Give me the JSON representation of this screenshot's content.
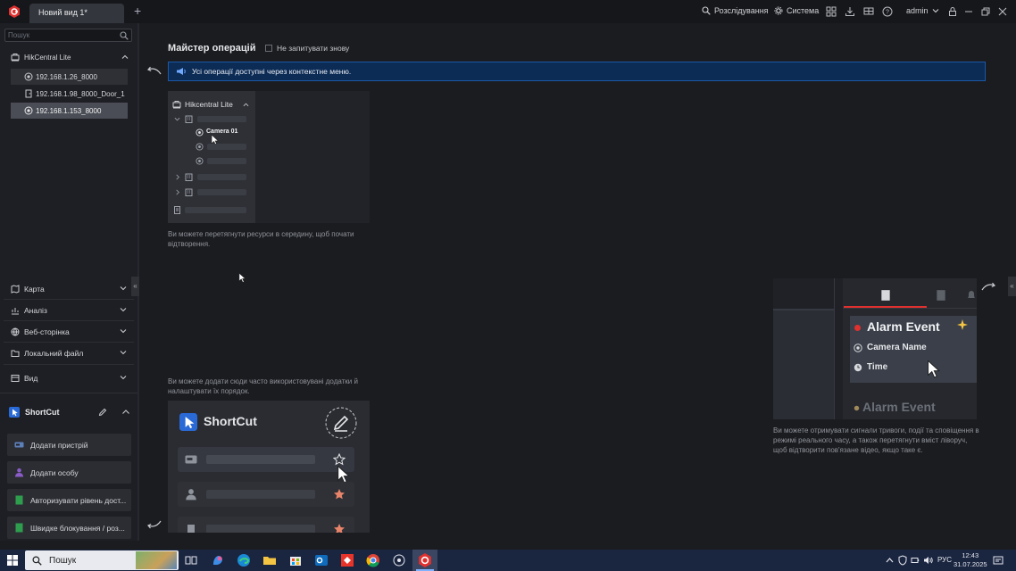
{
  "titlebar": {
    "tab_label": "Новий вид 1*",
    "investigation_label": "Розслідування",
    "system_label": "Система",
    "user_label": "admin"
  },
  "sidebar": {
    "search_placeholder": "Пошук",
    "root_label": "HikCentral Lite",
    "devices": [
      {
        "label": "192.168.1.26_8000",
        "selected": false
      },
      {
        "label": "192.168.1.98_8000_Door_1",
        "selected": false
      },
      {
        "label": "192.168.1.153_8000",
        "selected": true
      }
    ],
    "nav": [
      {
        "label": "Карта"
      },
      {
        "label": "Аналіз"
      },
      {
        "label": "Веб-сторінка"
      },
      {
        "label": "Локальний файл"
      },
      {
        "label": "Вид"
      }
    ],
    "shortcut_title": "ShortCut",
    "shortcuts": [
      {
        "label": "Додати пристрій"
      },
      {
        "label": "Додати особу"
      },
      {
        "label": "Авторизувати рівень дост..."
      },
      {
        "label": "Швидке блокування / роз..."
      }
    ]
  },
  "wizard": {
    "title": "Майстер операцій",
    "dont_ask_label": "Не запитувати знову",
    "banner_text": "Усі операції доступні через контекстне меню.",
    "card1": {
      "tree_title": "Hikcentral Lite",
      "camera_label": "Camera 01",
      "caption": "Ви можете перетягнути ресурси в середину, щоб почати відтворення."
    },
    "card2": {
      "caption": "Ви можете додати сюди часто використовувані додатки й налаштувати їх порядок.",
      "title": "ShortCut"
    },
    "card3": {
      "alarm_title": "Alarm Event",
      "camera_name": "Camera Name",
      "time_label": "Time",
      "alarm_title_2": "Alarm Event",
      "caption": "Ви можете отримувати сигнали тривоги, події та сповіщення в режимі реального часу, а також перетягнути вміст ліворуч, щоб відтворити пов'язане відео, якщо таке є."
    }
  },
  "taskbar": {
    "search_label": "Пошук",
    "lang": "РУС",
    "time": "12:43",
    "date": "31.07.2025"
  },
  "colors": {
    "accent": "#e0312f",
    "banner_bg": "#0c2b55",
    "banner_border": "#1c58a6",
    "star": "#e8846a"
  }
}
